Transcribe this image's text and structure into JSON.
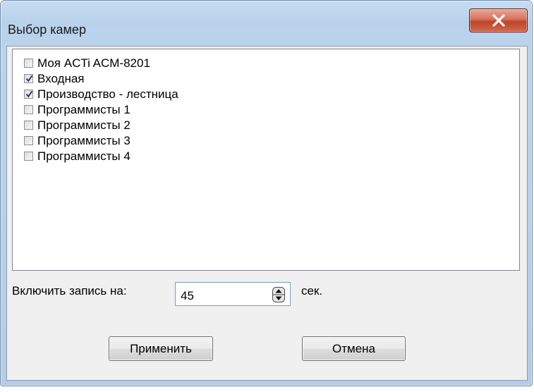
{
  "window": {
    "title": "Выбор камер"
  },
  "cameras": [
    {
      "label": "Моя ACTi ACM-8201",
      "checked": false
    },
    {
      "label": "Входная",
      "checked": true
    },
    {
      "label": "Производство - лестница",
      "checked": true
    },
    {
      "label": "Программисты 1",
      "checked": false
    },
    {
      "label": "Программисты 2",
      "checked": false
    },
    {
      "label": "Программисты 3",
      "checked": false
    },
    {
      "label": "Программисты 4",
      "checked": false
    }
  ],
  "recording": {
    "label": "Включить запись на:",
    "value": "45",
    "unit": "сек."
  },
  "buttons": {
    "apply": "Применить",
    "cancel": "Отмена"
  },
  "icons": {
    "close": "close-icon",
    "check": "check-icon",
    "spinner": "spinner-arrows-icon"
  }
}
